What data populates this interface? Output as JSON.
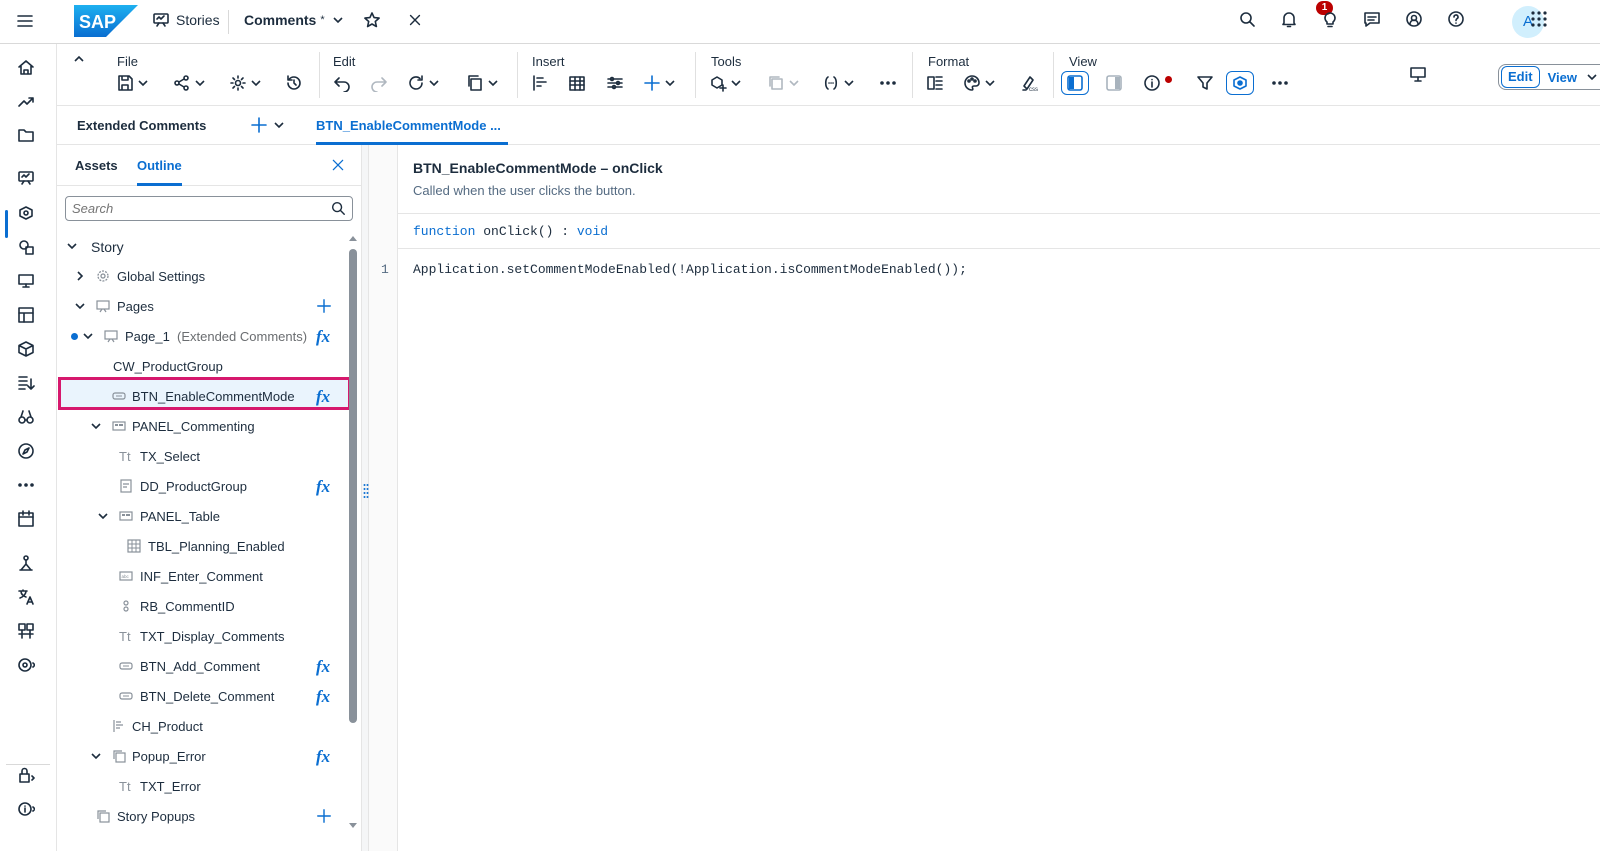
{
  "shell": {
    "logo_text": "SAP",
    "stories_label": "Stories",
    "doc_title": "Comments",
    "doc_modified_marker": "*",
    "notifications_count": "1",
    "avatar_initial": "A"
  },
  "toolbar": {
    "groups": {
      "file": "File",
      "edit": "Edit",
      "insert": "Insert",
      "tools": "Tools",
      "format": "Format",
      "view": "View"
    },
    "edit_label": "Edit",
    "view_label": "View"
  },
  "tabs": {
    "story_tab": "Extended Comments",
    "script_tab": "BTN_EnableCommentMode ..."
  },
  "panel": {
    "tab_assets": "Assets",
    "tab_outline": "Outline",
    "search_placeholder": "Search",
    "tree": {
      "story": "Story",
      "global_settings": "Global Settings",
      "pages": "Pages",
      "page1": "Page_1",
      "page1_suffix": "(Extended Comments)",
      "cw_productgroup": "CW_ProductGroup",
      "btn_enable": "BTN_EnableCommentMode",
      "panel_commenting": "PANEL_Commenting",
      "tx_select": "TX_Select",
      "dd_productgroup": "DD_ProductGroup",
      "panel_table": "PANEL_Table",
      "tbl_planning": "TBL_Planning_Enabled",
      "inf_enter": "INF_Enter_Comment",
      "rb_commentid": "RB_CommentID",
      "txt_display": "TXT_Display_Comments",
      "btn_add": "BTN_Add_Comment",
      "btn_delete": "BTN_Delete_Comment",
      "ch_product": "CH_Product",
      "popup_error": "Popup_Error",
      "txt_error": "TXT_Error",
      "story_popups": "Story Popups"
    },
    "icon_texts": {
      "text_widget": "Tt"
    },
    "fx_symbol": "fx"
  },
  "editor": {
    "event_title": "BTN_EnableCommentMode – onClick",
    "event_desc": "Called when the user clicks the button.",
    "sig_kw1": "function",
    "sig_name": " onClick() : ",
    "sig_kw2": "void",
    "line_number": "1",
    "code": "Application.setCommentModeEnabled(!Application.isCommentModeEnabled());"
  },
  "colors": {
    "accent": "#0a6ed1",
    "selection_outline": "#d6186d",
    "badge": "#bb0000"
  }
}
